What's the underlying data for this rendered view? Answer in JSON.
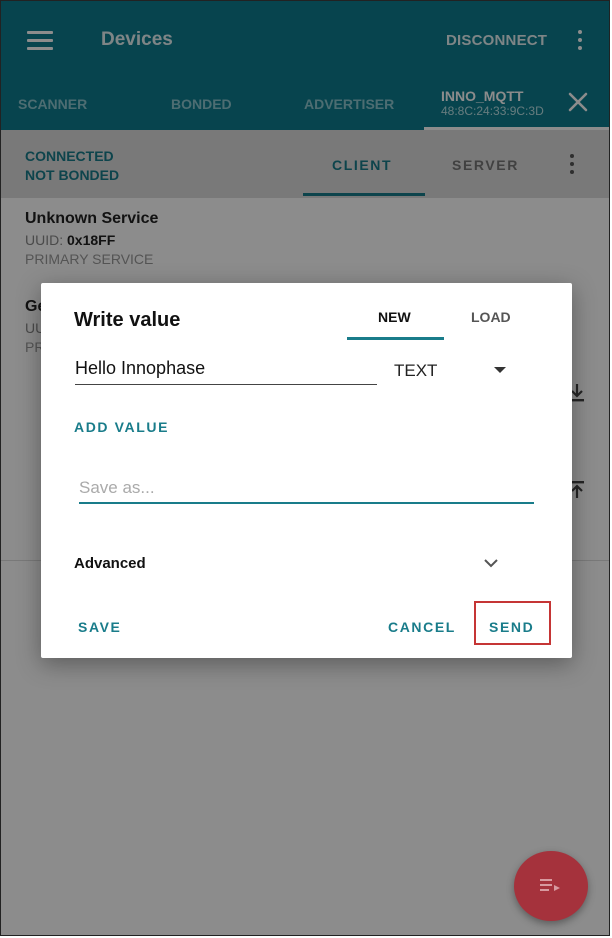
{
  "appbar": {
    "title": "Devices",
    "disconnect_label": "DISCONNECT",
    "menu_icon": "hamburger-icon",
    "overflow_icon": "more-vert-icon"
  },
  "device_tabs": {
    "items": [
      "SCANNER",
      "BONDED",
      "ADVERTISER"
    ],
    "active": {
      "name": "INNO_MQTT",
      "address": "48:8C:24:33:9C:3D"
    },
    "close_icon": "close-icon"
  },
  "connection": {
    "state": "CONNECTED",
    "bond_state": "NOT BONDED",
    "tabs": [
      "CLIENT",
      "SERVER"
    ],
    "active_tab": "CLIENT"
  },
  "services": [
    {
      "name": "Unknown Service",
      "uuid_label": "UUID:",
      "uuid": "0x18FF",
      "type": "PRIMARY SERVICE"
    },
    {
      "name_partial": "Ge",
      "uuid_partial": "UU",
      "type_partial": "PR"
    }
  ],
  "dialog": {
    "title": "Write value",
    "tabs": [
      "NEW",
      "LOAD"
    ],
    "active_tab": "NEW",
    "value": "Hello Innophase",
    "format": "TEXT",
    "add_value_label": "ADD VALUE",
    "save_as_placeholder": "Save as...",
    "advanced_label": "Advanced",
    "buttons": {
      "save": "SAVE",
      "cancel": "CANCEL",
      "send": "SEND"
    }
  },
  "colors": {
    "primary": "#0e7d8e",
    "accent": "#197c8a",
    "fab": "#a5323c",
    "highlight_box": "#c53535"
  }
}
